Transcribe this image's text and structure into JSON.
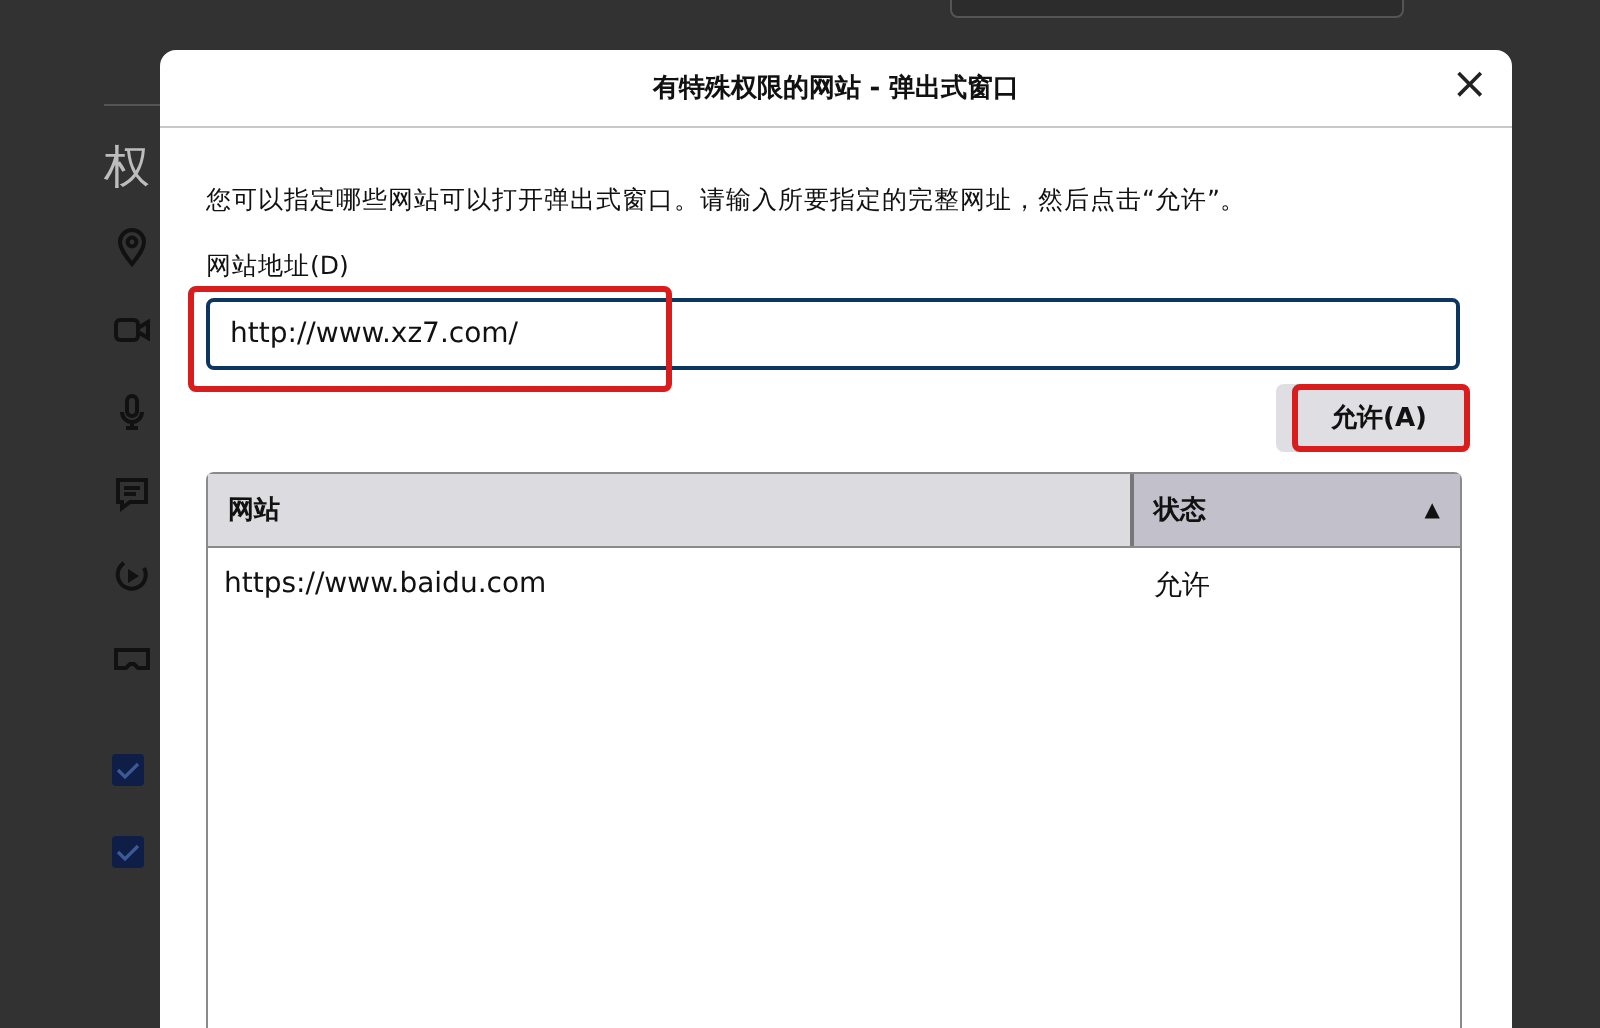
{
  "background": {
    "heading": "权",
    "icons": [
      {
        "kind": "location"
      },
      {
        "kind": "camera"
      },
      {
        "kind": "microphone"
      },
      {
        "kind": "chat"
      },
      {
        "kind": "autoplay"
      },
      {
        "kind": "vr"
      }
    ],
    "checkboxes": [
      {
        "checked": true
      },
      {
        "checked": true
      }
    ]
  },
  "dialog": {
    "title": "有特殊权限的网站 - 弹出式窗口",
    "close": "×",
    "description": "您可以指定哪些网站可以打开弹出式窗口。请输入所要指定的完整网址，然后点击“允许”。",
    "field": {
      "label": "网站地址(D)",
      "value": "http://www.xz7.com/",
      "highlighted": true
    },
    "button": {
      "label": "允许(A)",
      "highlighted": true
    },
    "table": {
      "columns": [
        {
          "label": "网站",
          "sorted": false
        },
        {
          "label": "状态",
          "sorted": true,
          "sort_indicator": "▲"
        }
      ],
      "rows": [
        [
          "https://www.baidu.com",
          "允许"
        ]
      ]
    }
  }
}
